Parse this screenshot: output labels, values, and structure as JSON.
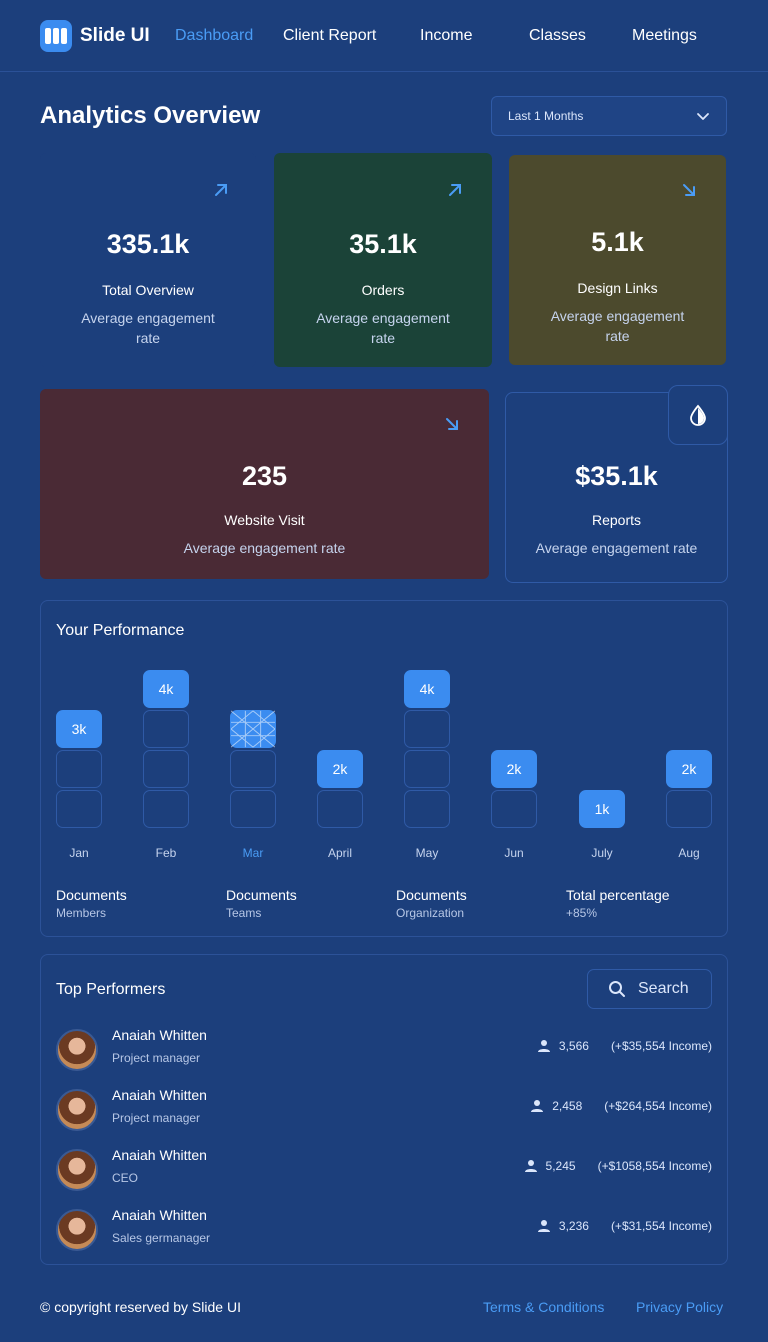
{
  "brand": {
    "name": "Slide UI"
  },
  "nav": {
    "items": [
      {
        "label": "Dashboard"
      },
      {
        "label": "Client Report"
      },
      {
        "label": "Income"
      },
      {
        "label": "Classes"
      },
      {
        "label": "Meetings"
      }
    ],
    "active_index": 0
  },
  "header": {
    "title": "Analytics Overview",
    "period": "Last 1 Months"
  },
  "stats": [
    {
      "value": "335.1k",
      "label": "Total Overview",
      "sub": "Average engagement rate",
      "trend": "up",
      "color": "#1c3f7c"
    },
    {
      "value": "35.1k",
      "label": "Orders",
      "sub": "Average engagement rate",
      "trend": "up",
      "color": "#1b4338"
    },
    {
      "value": "5.1k",
      "label": "Design Links",
      "sub": "Average engagement rate",
      "trend": "down",
      "color": "#4c4a2d"
    },
    {
      "value": "235",
      "label": "Website Visit",
      "sub": "Average engagement rate",
      "trend": "down",
      "color": "#4a2a35"
    },
    {
      "value": "$35.1k",
      "label": "Reports",
      "sub": "Average engagement rate",
      "trend": "none",
      "color": "#1c3f7c"
    }
  ],
  "performance": {
    "title": "Your Performance",
    "months": [
      {
        "label": "Jan",
        "value": "3k",
        "level": 3
      },
      {
        "label": "Feb",
        "value": "4k",
        "level": 4
      },
      {
        "label": "Mar",
        "value": "",
        "level": 3,
        "highlighted": true
      },
      {
        "label": "April",
        "value": "2k",
        "level": 2
      },
      {
        "label": "May",
        "value": "4k",
        "level": 4
      },
      {
        "label": "Jun",
        "value": "2k",
        "level": 2
      },
      {
        "label": "July",
        "value": "1k",
        "level": 1
      },
      {
        "label": "Aug",
        "value": "2k",
        "level": 2
      }
    ],
    "summary": [
      {
        "title": "Documents",
        "sub": "Members"
      },
      {
        "title": "Documents",
        "sub": "Teams"
      },
      {
        "title": "Documents",
        "sub": "Organization"
      },
      {
        "title": "Total percentage",
        "sub": "+85%"
      }
    ]
  },
  "performers": {
    "title": "Top Performers",
    "search_label": "Search",
    "rows": [
      {
        "name": "Anaiah Whitten",
        "role": "Project manager",
        "count": "3,566",
        "income": "(+$35,554 Income)"
      },
      {
        "name": "Anaiah Whitten",
        "role": "Project manager",
        "count": "2,458",
        "income": "(+$264,554 Income)"
      },
      {
        "name": "Anaiah Whitten",
        "role": "CEO",
        "count": "5,245",
        "income": "(+$1058,554 Income)"
      },
      {
        "name": "Anaiah Whitten",
        "role": "Sales germanager",
        "count": "3,236",
        "income": "(+$31,554 Income)"
      }
    ]
  },
  "footer": {
    "copyright": "© copyright reserved by Slide UI",
    "terms": "Terms & Conditions",
    "privacy": "Privacy Policy"
  },
  "colors": {
    "accent": "#3b8cf0",
    "background": "#1c3f7c",
    "link": "#4a9cf5"
  }
}
